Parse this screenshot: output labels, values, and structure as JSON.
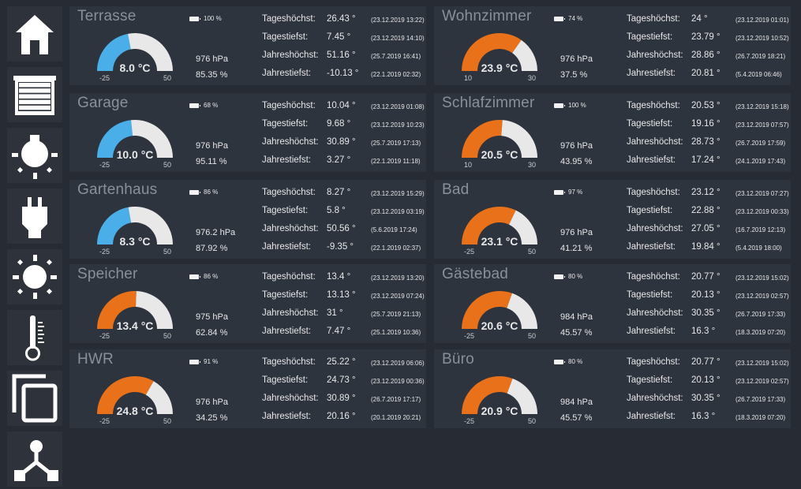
{
  "sidebar": {
    "items": [
      {
        "icon": "home-icon",
        "name": "nav-home"
      },
      {
        "icon": "shutter-icon",
        "name": "nav-shutters"
      },
      {
        "icon": "light-bulb-icon",
        "name": "nav-lights"
      },
      {
        "icon": "plug-icon",
        "name": "nav-sockets"
      },
      {
        "icon": "sun-icon",
        "name": "nav-weather"
      },
      {
        "icon": "thermometer-icon",
        "name": "nav-temperature"
      },
      {
        "icon": "copy-icon",
        "name": "nav-copy"
      },
      {
        "icon": "network-icon",
        "name": "nav-network"
      }
    ]
  },
  "stat_labels": [
    "Tageshöchst:",
    "Tagestiefst:",
    "Jahreshöchst:",
    "Jahrestiefst:"
  ],
  "colors": {
    "cold": "#4aafe9",
    "warm": "#e8711a",
    "track": "#e8e8e8"
  },
  "rooms": [
    {
      "name": "Terrasse",
      "battery": "100 %",
      "temp": 8.0,
      "temp_label": "8.0 °C",
      "min": -25,
      "max": 50,
      "min_label": "-25",
      "max_label": "50",
      "color": "cold",
      "pressure": "976 hPa",
      "humidity": "85.35 %",
      "stats": [
        {
          "value": "26.43 °",
          "date": "(23.12.2019 13:22)"
        },
        {
          "value": "7.45 °",
          "date": "(23.12.2019 14:10)"
        },
        {
          "value": "51.16 °",
          "date": "(25.7.2019 16:41)"
        },
        {
          "value": "-10.13 °",
          "date": "(22.1.2019 02:32)"
        }
      ]
    },
    {
      "name": "Wohnzimmer",
      "battery": "74 %",
      "temp": 23.9,
      "temp_label": "23.9 °C",
      "min": 10,
      "max": 30,
      "min_label": "10",
      "max_label": "30",
      "color": "warm",
      "pressure": "976 hPa",
      "humidity": "37.5 %",
      "stats": [
        {
          "value": "24 °",
          "date": "(23.12.2019 01:01)"
        },
        {
          "value": "23.79 °",
          "date": "(23.12.2019 10:52)"
        },
        {
          "value": "28.86 °",
          "date": "(26.7.2019 18:21)"
        },
        {
          "value": "20.81 °",
          "date": "(5.4.2019 06:46)"
        }
      ]
    },
    {
      "name": "Garage",
      "battery": "68 %",
      "temp": 10.0,
      "temp_label": "10.0 °C",
      "min": -25,
      "max": 50,
      "min_label": "-25",
      "max_label": "50",
      "color": "cold",
      "pressure": "976 hPa",
      "humidity": "95.11 %",
      "stats": [
        {
          "value": "10.04 °",
          "date": "(23.12.2019 01:08)"
        },
        {
          "value": "9.68 °",
          "date": "(23.12.2019 10:23)"
        },
        {
          "value": "30.89 °",
          "date": "(25.7.2019 17:13)"
        },
        {
          "value": "3.27 °",
          "date": "(22.1.2019 11:18)"
        }
      ]
    },
    {
      "name": "Schlafzimmer",
      "battery": "100 %",
      "temp": 20.5,
      "temp_label": "20.5 °C",
      "min": 10,
      "max": 30,
      "min_label": "10",
      "max_label": "30",
      "color": "warm",
      "pressure": "976 hPa",
      "humidity": "43.95 %",
      "stats": [
        {
          "value": "20.53 °",
          "date": "(23.12.2019 15:18)"
        },
        {
          "value": "19.16 °",
          "date": "(23.12.2019 07:57)"
        },
        {
          "value": "28.73 °",
          "date": "(26.7.2019 17:59)"
        },
        {
          "value": "17.24 °",
          "date": "(24.1.2019 17:43)"
        }
      ]
    },
    {
      "name": "Gartenhaus",
      "battery": "86 %",
      "temp": 8.3,
      "temp_label": "8.3 °C",
      "min": -25,
      "max": 50,
      "min_label": "-25",
      "max_label": "50",
      "color": "cold",
      "pressure": "976.2 hPa",
      "humidity": "87.92 %",
      "stats": [
        {
          "value": "8.27 °",
          "date": "(23.12.2019 15:29)"
        },
        {
          "value": "5.8 °",
          "date": "(23.12.2019 03:19)"
        },
        {
          "value": "50.56 °",
          "date": "(5.6.2019 17:24)"
        },
        {
          "value": "-9.35 °",
          "date": "(22.1.2019 02:37)"
        }
      ]
    },
    {
      "name": "Bad",
      "battery": "97 %",
      "temp": 23.1,
      "temp_label": "23.1 °C",
      "min": -25,
      "max": 50,
      "min_label": "-25",
      "max_label": "50",
      "color": "warm",
      "pressure": "976 hPa",
      "humidity": "41.21 %",
      "stats": [
        {
          "value": "23.12 °",
          "date": "(23.12.2019 07:27)"
        },
        {
          "value": "22.88 °",
          "date": "(23.12.2019 00:33)"
        },
        {
          "value": "27.05 °",
          "date": "(16.7.2019 12:13)"
        },
        {
          "value": "19.84 °",
          "date": "(5.4.2019 18:00)"
        }
      ]
    },
    {
      "name": "Speicher",
      "battery": "86 %",
      "temp": 13.4,
      "temp_label": "13.4 °C",
      "min": -25,
      "max": 50,
      "min_label": "-25",
      "max_label": "50",
      "color": "warm",
      "pressure": "975 hPa",
      "humidity": "62.84 %",
      "stats": [
        {
          "value": "13.4 °",
          "date": "(23.12.2019 13:20)"
        },
        {
          "value": "13.13 °",
          "date": "(23.12.2019 07:24)"
        },
        {
          "value": "31 °",
          "date": "(25.7.2019 21:13)"
        },
        {
          "value": "7.47 °",
          "date": "(25.1.2019 10:36)"
        }
      ]
    },
    {
      "name": "Gästebad",
      "battery": "80 %",
      "temp": 20.6,
      "temp_label": "20.6 °C",
      "min": -25,
      "max": 50,
      "min_label": "-25",
      "max_label": "50",
      "color": "warm",
      "pressure": "984 hPa",
      "humidity": "45.57 %",
      "stats": [
        {
          "value": "20.77 °",
          "date": "(23.12.2019 15:02)"
        },
        {
          "value": "20.13 °",
          "date": "(23.12.2019 02:57)"
        },
        {
          "value": "30.35 °",
          "date": "(26.7.2019 17:33)"
        },
        {
          "value": "16.3 °",
          "date": "(18.3.2019 07:20)"
        }
      ]
    },
    {
      "name": "HWR",
      "battery": "91 %",
      "temp": 24.8,
      "temp_label": "24.8 °C",
      "min": -25,
      "max": 50,
      "min_label": "-25",
      "max_label": "50",
      "color": "warm",
      "pressure": "976 hPa",
      "humidity": "34.25 %",
      "stats": [
        {
          "value": "25.22 °",
          "date": "(23.12.2019 06:06)"
        },
        {
          "value": "24.73 °",
          "date": "(23.12.2019 00:36)"
        },
        {
          "value": "30.89 °",
          "date": "(26.7.2019 17:17)"
        },
        {
          "value": "20.16 °",
          "date": "(20.1.2019 20:21)"
        }
      ]
    },
    {
      "name": "Büro",
      "battery": "80 %",
      "temp": 20.9,
      "temp_label": "20.9 °C",
      "min": -25,
      "max": 50,
      "min_label": "-25",
      "max_label": "50",
      "color": "warm",
      "pressure": "984 hPa",
      "humidity": "45.57 %",
      "stats": [
        {
          "value": "20.77 °",
          "date": "(23.12.2019 15:02)"
        },
        {
          "value": "20.13 °",
          "date": "(23.12.2019 02:57)"
        },
        {
          "value": "30.35 °",
          "date": "(26.7.2019 17:33)"
        },
        {
          "value": "16.3 °",
          "date": "(18.3.2019 07:20)"
        }
      ]
    }
  ]
}
